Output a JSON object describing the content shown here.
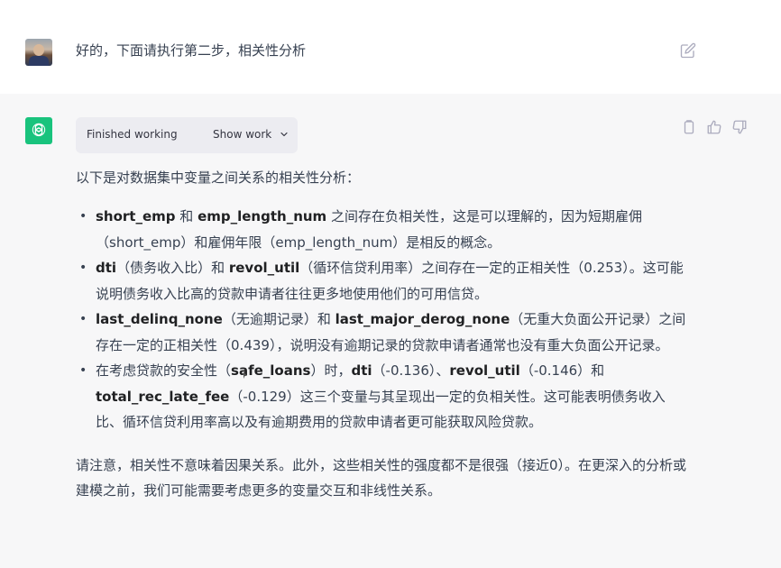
{
  "user_message": {
    "text": "好的，下面请执行第二步，相关性分析"
  },
  "assistant_message": {
    "status": {
      "label": "Finished working",
      "toggle_label": "Show work"
    },
    "intro": "以下是对数据集中变量之间关系的相关性分析：",
    "bullets": [
      {
        "parts": [
          {
            "b": "short_emp"
          },
          {
            "t": " 和 "
          },
          {
            "b": "emp_length_num"
          },
          {
            "t": " 之间存在负相关性，这是可以理解的，因为短期雇佣（short_emp）和雇佣年限（emp_length_num）是相反的概念。"
          }
        ]
      },
      {
        "parts": [
          {
            "b": "dti"
          },
          {
            "t": "（债务收入比）和 "
          },
          {
            "b": "revol_util"
          },
          {
            "t": "（循环信贷利用率）之间存在一定的正相关性（0.253）。这可能说明债务收入比高的贷款申请者往往更多地使用他们的可用信贷。"
          }
        ]
      },
      {
        "parts": [
          {
            "b": "last_delinq_none"
          },
          {
            "t": "（无逾期记录）和 "
          },
          {
            "b": "last_major_derog_none"
          },
          {
            "t": "（无重大负面公开记录）之间存在一定的正相关性（0.439），说明没有逾期记录的贷款申请者通常也没有重大负面公开记录。"
          }
        ]
      },
      {
        "parts": [
          {
            "t": "在考虑贷款的安全性（"
          },
          {
            "b": "safe_loans"
          },
          {
            "t": "）时，"
          },
          {
            "b": "dti"
          },
          {
            "t": "（-0.136）、"
          },
          {
            "b": "revol_util"
          },
          {
            "t": "（-0.146）和 "
          },
          {
            "b": "total_rec_late_fee"
          },
          {
            "t": "（-0.129）这三个变量与其呈现出一定的负相关性。这可能表明债务收入比、循环信贷利用率高以及有逾期费用的贷款申请者更可能获取风险贷款。"
          }
        ]
      }
    ],
    "note": "请注意，相关性不意味着因果关系。此外，这些相关性的强度都不是很强（接近0）。在更深入的分析或建模之前，我们可能需要考虑更多的变量交互和非线性关系。"
  },
  "icons": {
    "edit": "edit-icon",
    "copy": "copy-icon",
    "thumbs_up": "thumbs-up-icon",
    "thumbs_down": "thumbs-down-icon",
    "chevron": "chevron-down-icon",
    "bot_logo": "openai-logo-icon"
  },
  "colors": {
    "bot_avatar_bg": "#19c37d",
    "assistant_bg": "#f7f7f8",
    "status_box_bg": "#ececf1"
  }
}
